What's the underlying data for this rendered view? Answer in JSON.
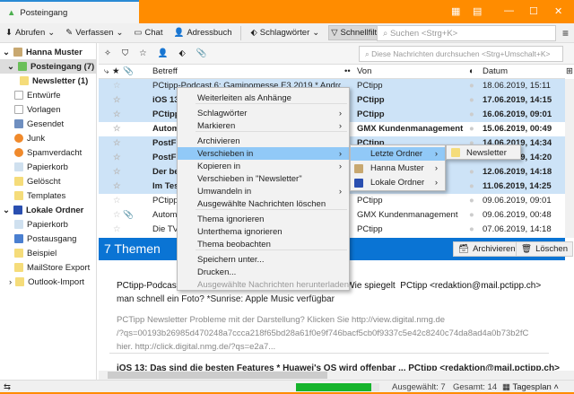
{
  "window": {
    "tab_title": "Posteingang",
    "accent": "#ff8c00"
  },
  "toolbar": {
    "abrufen": "Abrufen",
    "verfassen": "Verfassen",
    "chat": "Chat",
    "adressbuch": "Adressbuch",
    "schlagwoerter": "Schlagwörter",
    "schnellfilter": "Schnellfilter",
    "search_placeholder": "Suchen <Strg+K>"
  },
  "sidebar": {
    "account": "Hanna Muster",
    "items": [
      "Posteingang (7)",
      "Newsletter (1)",
      "Entwürfe",
      "Vorlagen",
      "Gesendet",
      "Junk",
      "Spamverdacht",
      "Papierkorb",
      "Gelöscht",
      "Templates"
    ],
    "local": "Lokale Ordner",
    "local_items": [
      "Papierkorb",
      "Postausgang",
      "Beispiel",
      "MailStore Export",
      "Outlook-Import"
    ]
  },
  "list": {
    "quick_search_placeholder": "Diese Nachrichten durchsuchen <Strg+Umschalt+K>",
    "col_subject": "Betreff",
    "col_from": "Von",
    "col_date": "Datum",
    "rows": [
      {
        "subject": "PCtipp-Podcast 6: Gaminomesse E3 2019 * Android/i...",
        "from": "PCtipp",
        "date": "18.06.2019, 15:11",
        "sel": true,
        "bold": false
      },
      {
        "subject": "iOS 13",
        "from": "PCtipp",
        "date": "17.06.2019, 14:15",
        "sel": true,
        "bold": true
      },
      {
        "subject": "PCtipp",
        "from": "PCtipp",
        "date": "16.06.2019, 09:01",
        "sel": true,
        "bold": true
      },
      {
        "subject": "Autom",
        "from": "GMX Kundenmanagement",
        "date": "15.06.2019, 00:49",
        "sel": false,
        "bold": true
      },
      {
        "subject": "PostFi",
        "from": "PCtipp",
        "date": "14.06.2019, 14:34",
        "sel": true,
        "bold": true
      },
      {
        "subject": "PostFi",
        "from": "",
        "date": "13.06.2019, 14:20",
        "sel": true,
        "bold": true
      },
      {
        "subject": "Der be",
        "from": "",
        "date": "12.06.2019, 14:18",
        "sel": true,
        "bold": true
      },
      {
        "subject": "Im Tes",
        "from": "",
        "date": "11.06.2019, 14:25",
        "sel": true,
        "bold": true
      },
      {
        "subject": "PCtipp",
        "from": "PCtipp",
        "date": "09.06.2019, 09:01",
        "sel": false,
        "bold": false
      },
      {
        "subject": "Autom",
        "from": "GMX Kundenmanagement",
        "date": "09.06.2019, 00:48",
        "sel": false,
        "bold": false,
        "attach": true
      },
      {
        "subject": "Die TV",
        "from": "PCtipp",
        "date": "07.06.2019, 14:18",
        "sel": false,
        "bold": false
      }
    ]
  },
  "context_menu": [
    "Weiterleiten als Anhänge",
    "Schlagwörter",
    "Markieren",
    "Archivieren",
    "Verschieben in",
    "Kopieren in",
    "Verschieben in \"Newsletter\"",
    "Umwandeln in",
    "Ausgewählte Nachrichten löschen",
    "Thema ignorieren",
    "Unterthema ignorieren",
    "Thema beobachten",
    "Speichern unter...",
    "Drucken...",
    "Ausgewählte Nachrichten herunterladen"
  ],
  "submenu": [
    "Letzte Ordner",
    "Hanna Muster",
    "Lokale Ordner"
  ],
  "subsubmenu": [
    "Newsletter"
  ],
  "preview": {
    "title": "7 Themen",
    "archive": "Archivieren",
    "delete": "Löschen",
    "item1_subject_a": "PCtipp-Podcast 6: Gaminomesse E3 2019 * Android/iOS: Wie spiegelt",
    "item1_from": "PCtipp <redaktion@mail.pctipp.ch>",
    "item1_subject_b": "man schnell ein Foto? *Sunrise: Apple Music verfügbar",
    "item1_body": [
      "PCTipp Newsletter Probleme mit der Darstellung? Klicken Sie http://view.digital.nmg.de",
      "/?qs=00193b26985d470248a7ccca218f65bd28a61f0e9f746bacf5cb0f9337c5e42c8240c74da8ad4a0b73b2fC",
      "hier. http://click.digital.nmg.de/?qs=e2a7..."
    ],
    "item2": "iOS 13: Das sind die besten Features * Huawei's OS wird offenbar ...   PCtipp <redaktion@mail.pctipp.ch>"
  },
  "status": {
    "selected": "Ausgewählt: 7",
    "total": "Gesamt: 14",
    "today": "Tagesplan",
    "progress": 0.9
  }
}
